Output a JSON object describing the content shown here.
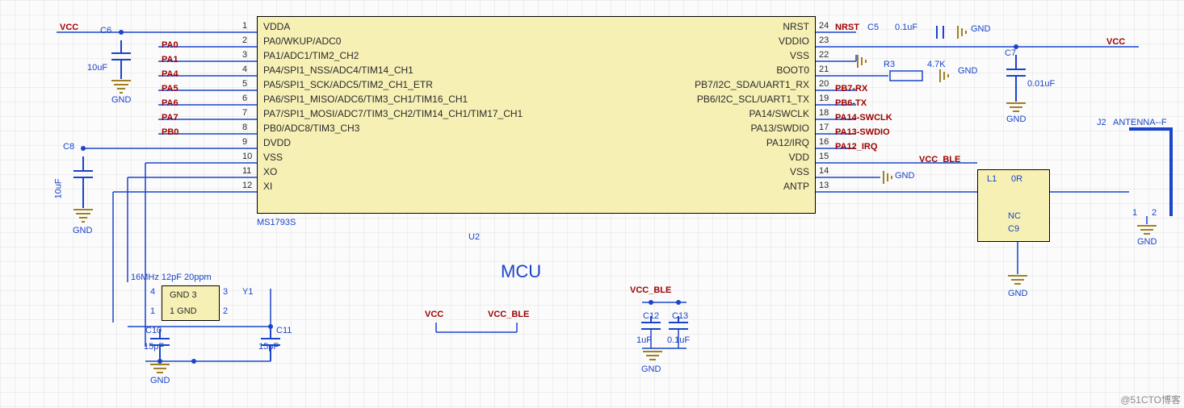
{
  "ic": {
    "ref": "U2",
    "part": "MS1793S",
    "title": "MCU",
    "left_pins": [
      {
        "num": "1",
        "name": "VDDA"
      },
      {
        "num": "2",
        "name": "PA0/WKUP/ADC0"
      },
      {
        "num": "3",
        "name": "PA1/ADC1/TIM2_CH2"
      },
      {
        "num": "4",
        "name": "PA4/SPI1_NSS/ADC4/TIM14_CH1"
      },
      {
        "num": "5",
        "name": "PA5/SPI1_SCK/ADC5/TIM2_CH1_ETR"
      },
      {
        "num": "6",
        "name": "PA6/SPI1_MISO/ADC6/TIM3_CH1/TIM16_CH1"
      },
      {
        "num": "7",
        "name": "PA7/SPI1_MOSI/ADC7/TIM3_CH2/TIM14_CH1/TIM17_CH1"
      },
      {
        "num": "8",
        "name": "PB0/ADC8/TIM3_CH3"
      },
      {
        "num": "9",
        "name": "DVDD"
      },
      {
        "num": "10",
        "name": "VSS"
      },
      {
        "num": "11",
        "name": "XO"
      },
      {
        "num": "12",
        "name": "XI"
      }
    ],
    "right_pins": [
      {
        "num": "24",
        "name": "NRST"
      },
      {
        "num": "23",
        "name": "VDDIO"
      },
      {
        "num": "22",
        "name": "VSS"
      },
      {
        "num": "21",
        "name": "BOOT0"
      },
      {
        "num": "20",
        "name": "PB7/I2C_SDA/UART1_RX"
      },
      {
        "num": "19",
        "name": "PB6/I2C_SCL/UART1_TX"
      },
      {
        "num": "18",
        "name": "PA14/SWCLK"
      },
      {
        "num": "17",
        "name": "PA13/SWDIO"
      },
      {
        "num": "16",
        "name": "PA12/IRQ"
      },
      {
        "num": "15",
        "name": "VDD"
      },
      {
        "num": "14",
        "name": "VSS"
      },
      {
        "num": "13",
        "name": "ANTP"
      }
    ]
  },
  "nets_left": [
    "PA0",
    "PA1",
    "PA4",
    "PA5",
    "PA6",
    "PA7",
    "PB0"
  ],
  "nets_right": [
    {
      "label": "NRST",
      "extra": "C5",
      "val": "0.1uF"
    },
    {
      "label": "R3",
      "val": "4.7K"
    },
    {
      "label": "PB7-RX"
    },
    {
      "label": "PB6-TX"
    },
    {
      "label": "PA14-SWCLK"
    },
    {
      "label": "PA13-SWDIO"
    },
    {
      "label": "PA12_IRQ"
    }
  ],
  "power": {
    "vcc": "VCC",
    "vcc_ble": "VCC_BLE",
    "gnd": "GND"
  },
  "caps": {
    "c6": {
      "ref": "C6",
      "val": "10uF"
    },
    "c7": {
      "ref": "C7",
      "val": "0.01uF"
    },
    "c8": {
      "ref": "C8",
      "val": "10uF"
    },
    "c9": {
      "ref": "C9",
      "val": "NC"
    },
    "c10": {
      "ref": "C10",
      "val": "15pF"
    },
    "c11": {
      "ref": "C11",
      "val": "15pF"
    },
    "c12": {
      "ref": "C12",
      "val": "1uF"
    },
    "c13": {
      "ref": "C13",
      "val": "0.1uF"
    }
  },
  "ind": {
    "ref": "L1",
    "val": "0R"
  },
  "crystal": {
    "spec": "16MHz 12pF 20ppm",
    "ref": "Y1",
    "pins": [
      "GND 3",
      "1 GND"
    ],
    "vals": [
      "3",
      "2",
      "1",
      "4"
    ]
  },
  "antenna": {
    "ref": "J2",
    "label": "ANTENNA--F",
    "pins": [
      "1",
      "2"
    ]
  },
  "watermark": "@51CTO博客"
}
